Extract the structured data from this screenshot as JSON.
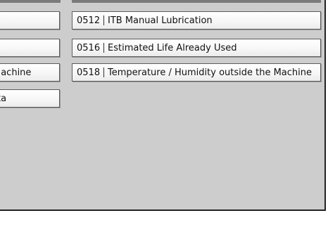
{
  "left_column": {
    "items": [
      {
        "label": ""
      },
      {
        "label": ""
      },
      {
        "label": "Machine"
      },
      {
        "label": "ta"
      }
    ]
  },
  "right_column": {
    "items": [
      {
        "code": "0512",
        "label": "ITB Manual Lubrication"
      },
      {
        "code": "0516",
        "label": "Estimated Life Already Used"
      },
      {
        "code": "0518",
        "label": "Temperature / Humidity outside the Machine"
      }
    ]
  }
}
